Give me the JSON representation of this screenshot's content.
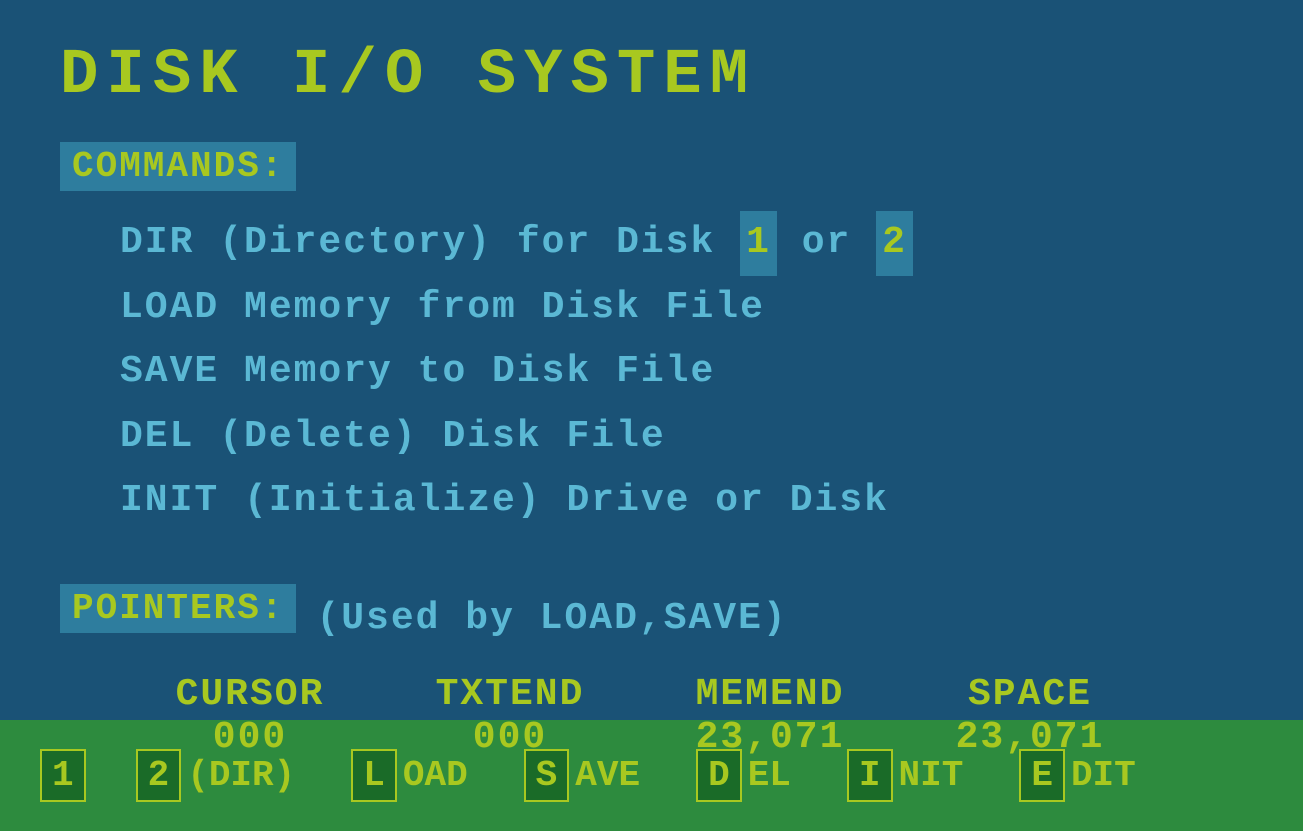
{
  "title": "DISK  I/O  SYSTEM",
  "commands_header": "COMMANDS:",
  "commands": [
    {
      "key": "DIR",
      "text": "(Directory) for Disk ",
      "disk1": "1",
      "middle": " or ",
      "disk2": "2",
      "id": "dir-command"
    },
    {
      "key": "LOAD",
      "text": "Memory from Disk File",
      "id": "load-command"
    },
    {
      "key": "SAVE",
      "text": "Memory to Disk File",
      "id": "save-command"
    },
    {
      "key": "DEL",
      "text": "(Delete) Disk File",
      "id": "del-command"
    },
    {
      "key": "INIT",
      "text": "(Initialize) Drive or Disk",
      "id": "init-command"
    }
  ],
  "pointers_header": "POINTERS:",
  "pointers_used": "(Used by LOAD,SAVE)",
  "pointer_columns": [
    "CURSOR",
    "TXTEND",
    "MEMEND",
    "SPACE"
  ],
  "pointer_values": [
    "000",
    "000",
    "23,071",
    "23,071"
  ],
  "bottom_buttons": [
    {
      "key": "1",
      "label": "",
      "id": "btn-1"
    },
    {
      "key": "2",
      "label": "(DIR)",
      "id": "btn-2-dir"
    },
    {
      "key": "L",
      "label": "OAD",
      "id": "btn-load"
    },
    {
      "key": "S",
      "label": "AVE",
      "id": "btn-save"
    },
    {
      "key": "D",
      "label": "EL",
      "id": "btn-del"
    },
    {
      "key": "I",
      "label": "NIT",
      "id": "btn-init"
    },
    {
      "key": "E",
      "label": "DIT",
      "id": "btn-edit"
    }
  ]
}
